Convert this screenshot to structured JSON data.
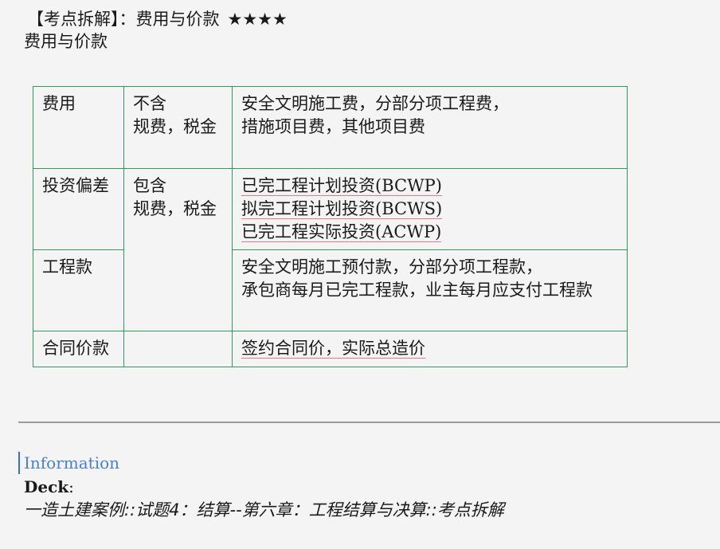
{
  "heading": {
    "label": "【考点拆解】：",
    "topic": "费用与价款",
    "stars": "★★★★"
  },
  "subheading": "费用与价款",
  "table": {
    "row1": {
      "col1": "费用",
      "col2_line1": "不含",
      "col2_line2": "规费，税金",
      "col3_line1": "安全文明施工费，分部分项工程费，",
      "col3_line2": "措施项目费，其他项目费"
    },
    "row2": {
      "col1": "投资偏差",
      "col3_line1_cn": "已完工程计划投资",
      "col3_line1_abbr": "(BCWP)",
      "col3_line2_cn": "拟完工程计划投资",
      "col3_line2_abbr": "(BCWS)",
      "col3_line3_cn": "已完工程实际投资",
      "col3_line3_abbr": "(ACWP)"
    },
    "merged_col2_line1": "包含",
    "merged_col2_line2": "规费，税金",
    "row3": {
      "col1": "工程款",
      "col3_line1": "安全文明施工预付款，分部分项工程款，",
      "col3_line2": "承包商每月已完工程款，业主每月应支付工程款"
    },
    "row4": {
      "col1": "合同价款",
      "col3_line1": "签约合同价，实际总造价"
    }
  },
  "info": {
    "title": "Information",
    "deck_label": "Deck",
    "deck_colon": ":",
    "deck_path": "一造土建案例::试题4：结算--第六章：工程结算与决算::考点拆解"
  },
  "colors": {
    "table_border": "#2e9a5b",
    "underline": "#e27a8a",
    "info_title": "#4a7fd8",
    "divider": "#9a9a9a"
  }
}
